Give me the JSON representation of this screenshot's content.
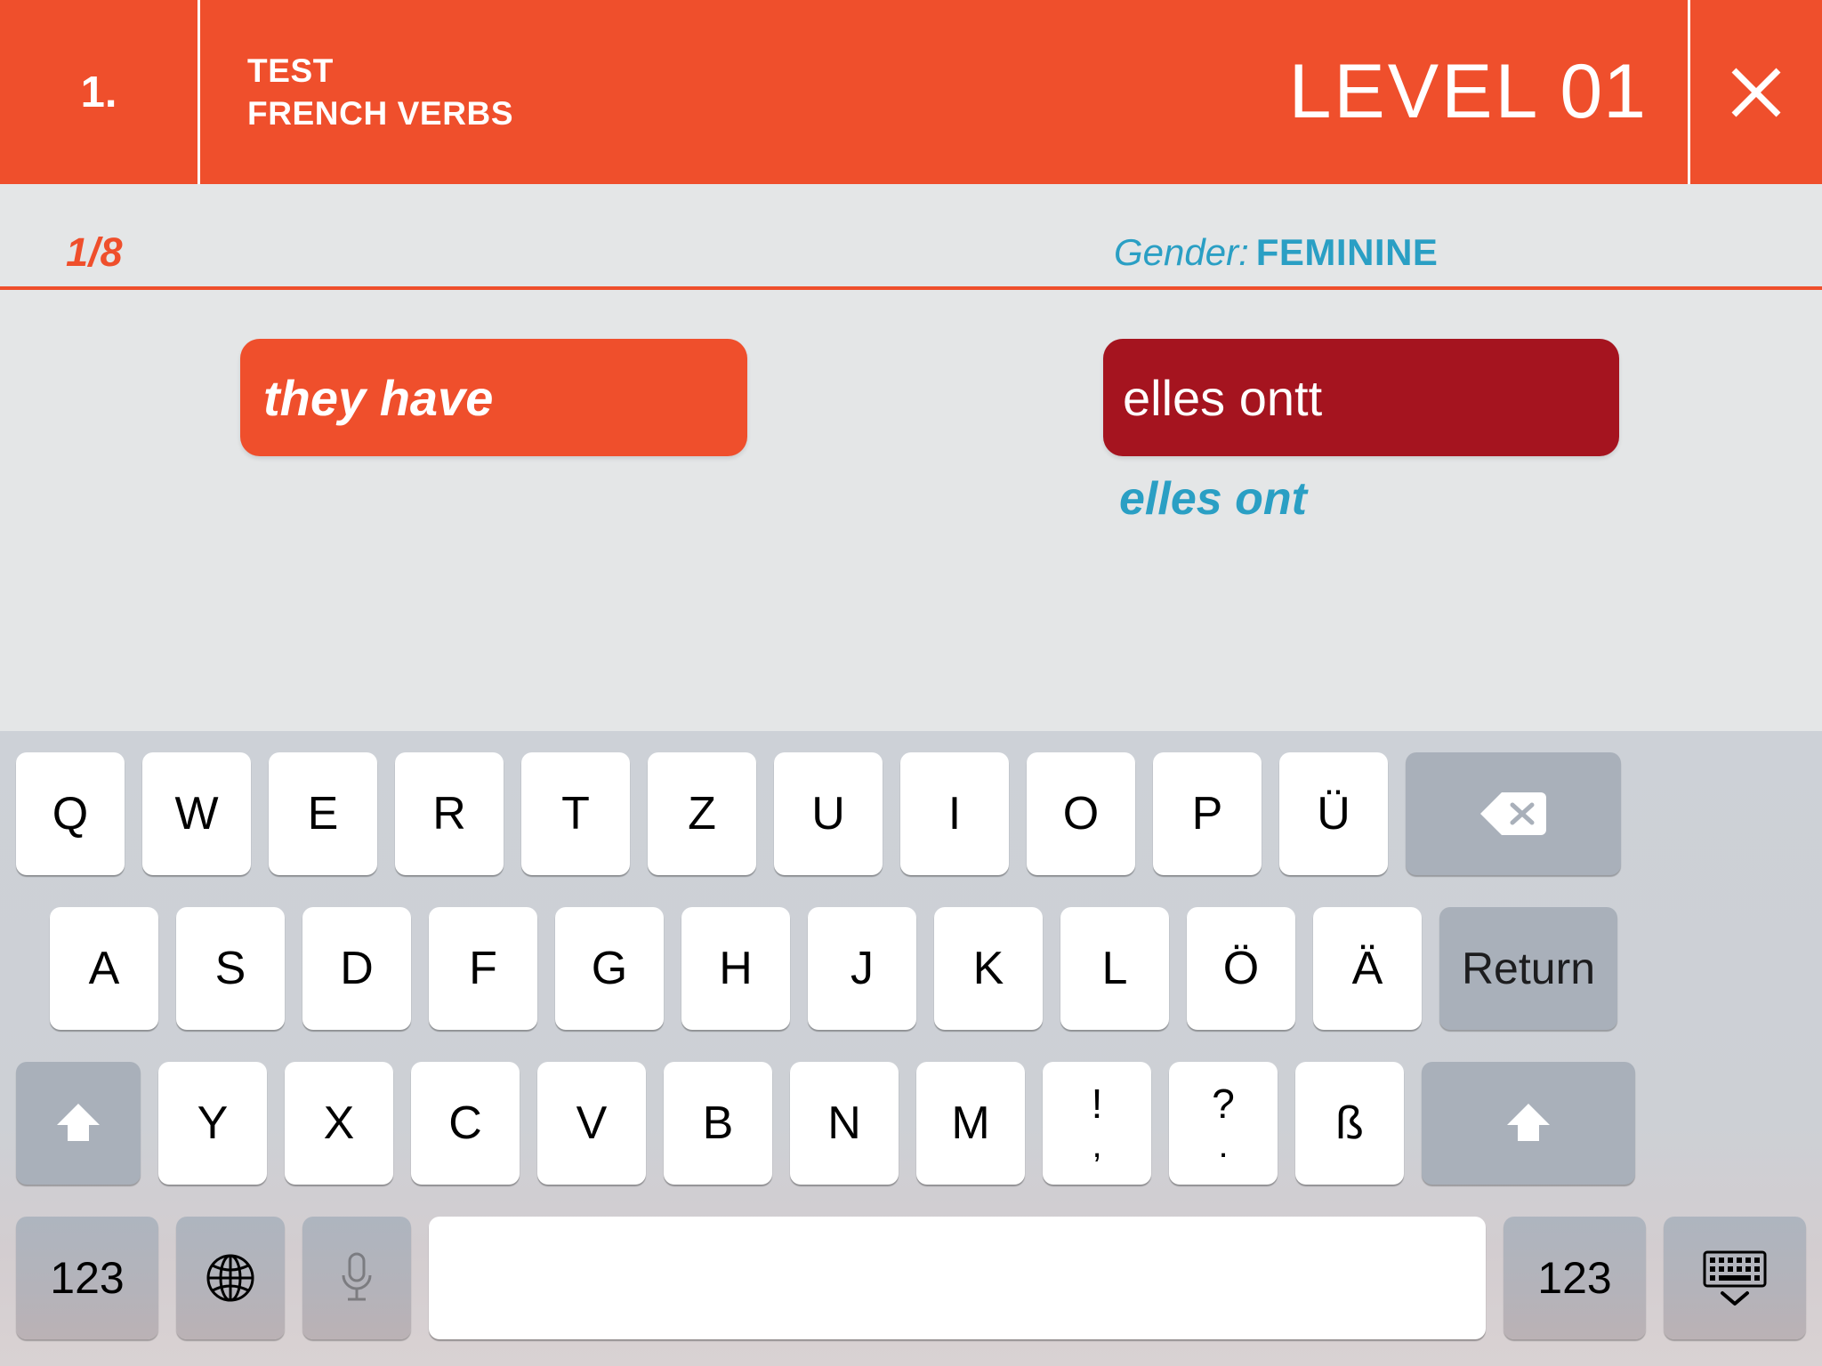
{
  "header": {
    "index": "1.",
    "title_line1": "TEST",
    "title_line2": "FRENCH VERBS",
    "level_word": "LEVEL",
    "level_number": "01",
    "close_icon": "close-icon",
    "background_color": "#ef4f2c"
  },
  "status": {
    "progress": "1/8",
    "gender_label": "Gender:",
    "gender_value": "FEMININE",
    "progress_color": "#ef4f2c",
    "gender_color": "#2a9fc4"
  },
  "content": {
    "prompt": "they have",
    "prompt_color": "#ef4f2c",
    "answer": "elles ontt",
    "answer_color": "#a5141f",
    "correction": "elles ont",
    "correction_color": "#2a9fc4"
  },
  "keyboard": {
    "layout": "QWERTZ",
    "row1": [
      "Q",
      "W",
      "E",
      "R",
      "T",
      "Z",
      "U",
      "I",
      "O",
      "P",
      "Ü"
    ],
    "row1_action": "backspace-icon",
    "row2": [
      "A",
      "S",
      "D",
      "F",
      "G",
      "H",
      "J",
      "K",
      "L",
      "Ö",
      "Ä"
    ],
    "row2_action": "Return",
    "row3_shift_left": "shift-icon",
    "row3": [
      "Y",
      "X",
      "C",
      "V",
      "B",
      "N",
      "M"
    ],
    "row3_dual": [
      {
        "top": "!",
        "bot": ","
      },
      {
        "top": "?",
        "bot": "."
      }
    ],
    "row3_eszett": "ß",
    "row3_shift_right": "shift-icon",
    "row4_num_left": "123",
    "row4_globe": "globe-icon",
    "row4_mic": "microphone-icon",
    "row4_space": "",
    "row4_num_right": "123",
    "row4_hide": "hide-keyboard-icon"
  }
}
